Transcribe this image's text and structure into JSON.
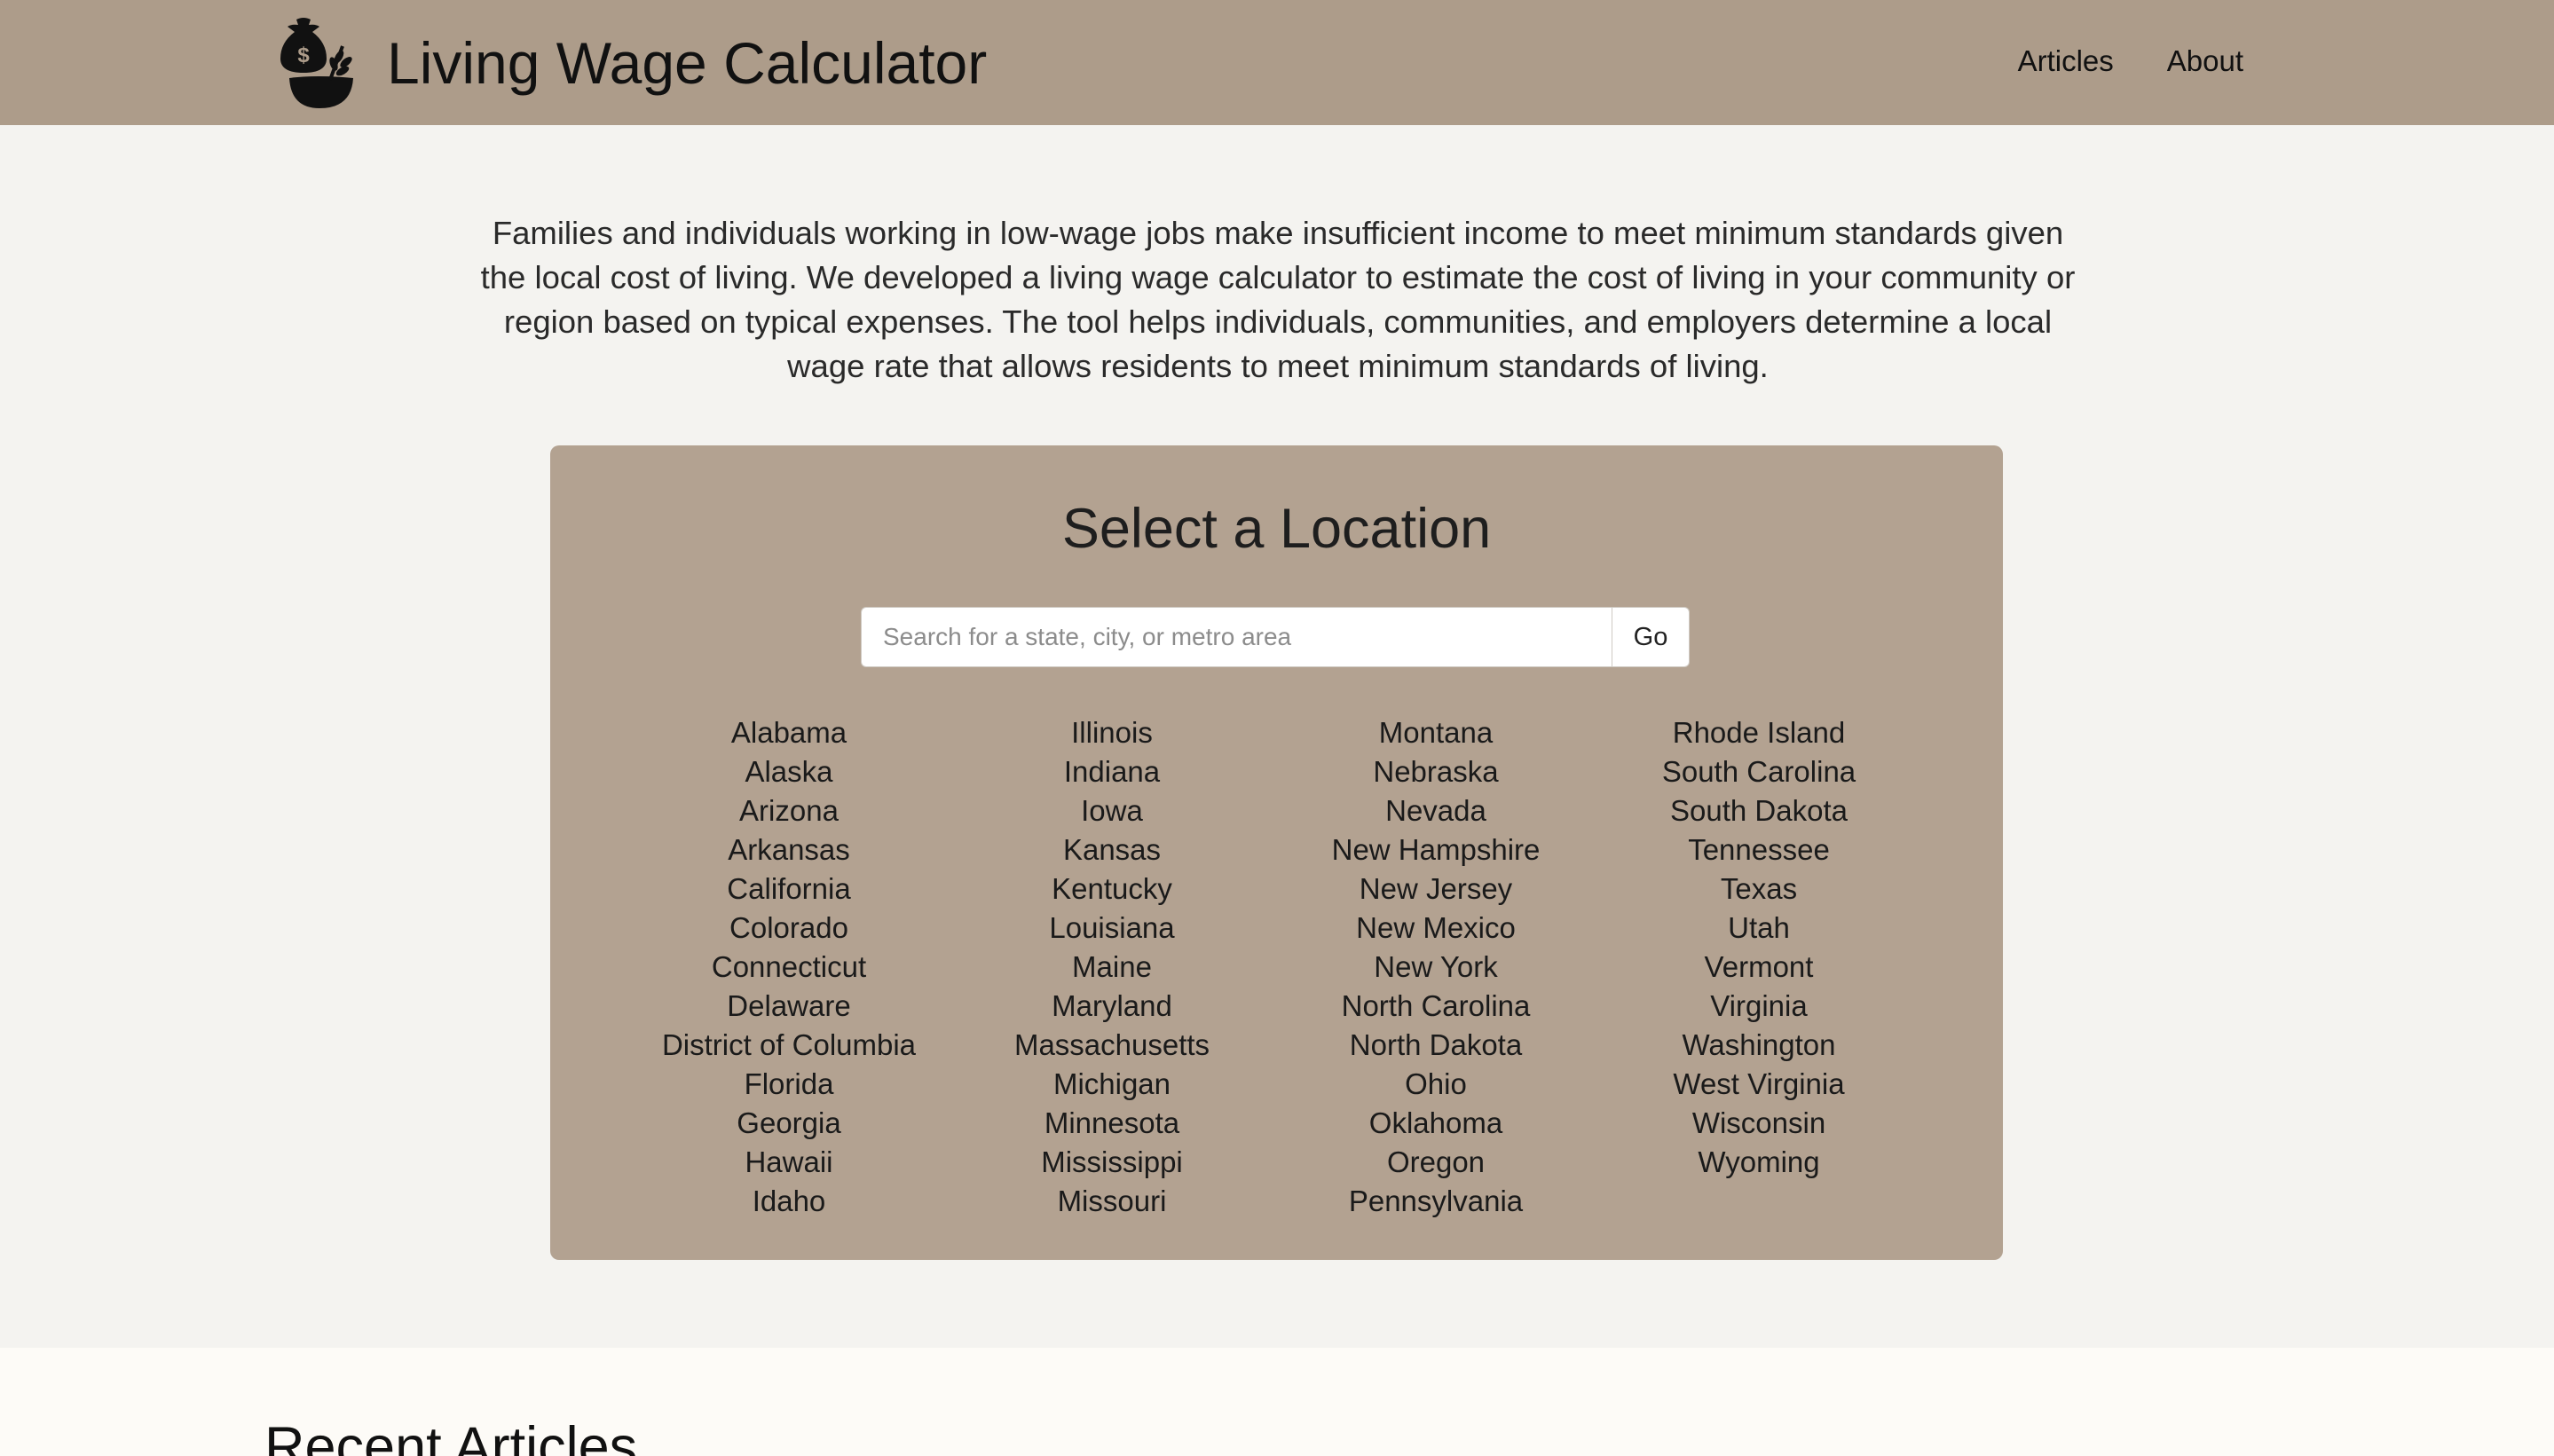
{
  "header": {
    "title": "Living Wage Calculator",
    "nav": [
      "Articles",
      "About"
    ]
  },
  "intro": "Families and individuals working in low-wage jobs make insufficient income to meet minimum standards given the local cost of living. We developed a living wage calculator to estimate the cost of living in your community or region based on typical expenses. The tool helps individuals, communities, and employers determine a local wage rate that allows residents to meet minimum standards of living.",
  "location": {
    "title": "Select a Location",
    "search_placeholder": "Search for a state, city, or metro area",
    "go_label": "Go",
    "columns": [
      [
        "Alabama",
        "Alaska",
        "Arizona",
        "Arkansas",
        "California",
        "Colorado",
        "Connecticut",
        "Delaware",
        "District of Columbia",
        "Florida",
        "Georgia",
        "Hawaii",
        "Idaho"
      ],
      [
        "Illinois",
        "Indiana",
        "Iowa",
        "Kansas",
        "Kentucky",
        "Louisiana",
        "Maine",
        "Maryland",
        "Massachusetts",
        "Michigan",
        "Minnesota",
        "Mississippi",
        "Missouri"
      ],
      [
        "Montana",
        "Nebraska",
        "Nevada",
        "New Hampshire",
        "New Jersey",
        "New Mexico",
        "New York",
        "North Carolina",
        "North Dakota",
        "Ohio",
        "Oklahoma",
        "Oregon",
        "Pennsylvania"
      ],
      [
        "Rhode Island",
        "South Carolina",
        "South Dakota",
        "Tennessee",
        "Texas",
        "Utah",
        "Vermont",
        "Virginia",
        "Washington",
        "West Virginia",
        "Wisconsin",
        "Wyoming"
      ]
    ]
  },
  "recent": {
    "title": "Recent Articles"
  },
  "colors": {
    "header_bg": "#ad9c8a",
    "panel_bg": "#b3a291",
    "page_bg": "#f4f3f0",
    "footer_bg": "#fdfbf7"
  },
  "icons": {
    "logo": "money-bag-wheat-bowl-icon"
  }
}
